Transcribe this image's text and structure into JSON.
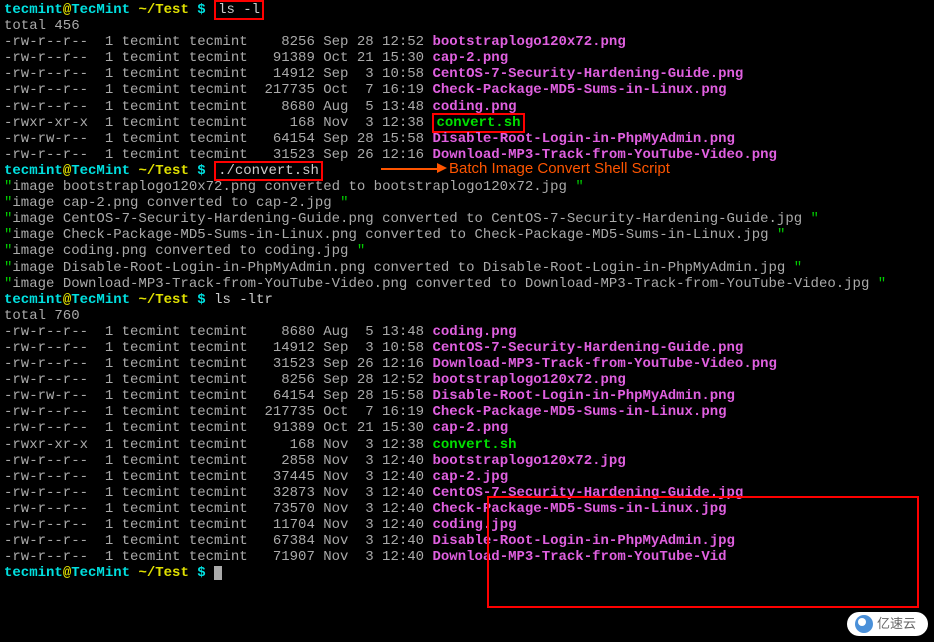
{
  "prompt1": {
    "user": "tecmint",
    "at": "@",
    "host": "TecMint",
    "path": "~/Test",
    "dollar": "$",
    "cmd": "ls -l"
  },
  "total1": "total 456",
  "ls1": [
    {
      "perm": "-rw-r--r--",
      "n": "1",
      "u": "tecmint",
      "g": "tecmint",
      "size": "   8256",
      "date": "Sep 28 12:52",
      "file": "bootstraplogo120x72.png",
      "cls": "png"
    },
    {
      "perm": "-rw-r--r--",
      "n": "1",
      "u": "tecmint",
      "g": "tecmint",
      "size": "  91389",
      "date": "Oct 21 15:30",
      "file": "cap-2.png",
      "cls": "png"
    },
    {
      "perm": "-rw-r--r--",
      "n": "1",
      "u": "tecmint",
      "g": "tecmint",
      "size": "  14912",
      "date": "Sep  3 10:58",
      "file": "CentOS-7-Security-Hardening-Guide.png",
      "cls": "png"
    },
    {
      "perm": "-rw-r--r--",
      "n": "1",
      "u": "tecmint",
      "g": "tecmint",
      "size": " 217735",
      "date": "Oct  7 16:19",
      "file": "Check-Package-MD5-Sums-in-Linux.png",
      "cls": "png"
    },
    {
      "perm": "-rw-r--r--",
      "n": "1",
      "u": "tecmint",
      "g": "tecmint",
      "size": "   8680",
      "date": "Aug  5 13:48",
      "file": "coding.png",
      "cls": "png"
    },
    {
      "perm": "-rwxr-xr-x",
      "n": "1",
      "u": "tecmint",
      "g": "tecmint",
      "size": "    168",
      "date": "Nov  3 12:38",
      "file": "convert.sh",
      "cls": "sh",
      "box": true
    },
    {
      "perm": "-rw-rw-r--",
      "n": "1",
      "u": "tecmint",
      "g": "tecmint",
      "size": "  64154",
      "date": "Sep 28 15:58",
      "file": "Disable-Root-Login-in-PhpMyAdmin.png",
      "cls": "png"
    },
    {
      "perm": "-rw-r--r--",
      "n": "1",
      "u": "tecmint",
      "g": "tecmint",
      "size": "  31523",
      "date": "Sep 26 12:16",
      "file": "Download-MP3-Track-from-YouTube-Video.png",
      "cls": "png"
    }
  ],
  "prompt2": {
    "user": "tecmint",
    "at": "@",
    "host": "TecMint",
    "path": "~/Test",
    "dollar": "$",
    "cmd": "./convert.sh"
  },
  "annotation": "Batch Image Convert Shell Script",
  "output": [
    "\"image bootstraplogo120x72.png converted to bootstraplogo120x72.jpg \"",
    "\"image cap-2.png converted to cap-2.jpg \"",
    "\"image CentOS-7-Security-Hardening-Guide.png converted to CentOS-7-Security-Hardening-Guide.jpg \"",
    "\"image Check-Package-MD5-Sums-in-Linux.png converted to Check-Package-MD5-Sums-in-Linux.jpg \"",
    "\"image coding.png converted to coding.jpg \"",
    "\"image Disable-Root-Login-in-PhpMyAdmin.png converted to Disable-Root-Login-in-PhpMyAdmin.jpg \"",
    "\"image Download-MP3-Track-from-YouTube-Video.png converted to Download-MP3-Track-from-YouTube-Video.jpg \""
  ],
  "prompt3": {
    "user": "tecmint",
    "at": "@",
    "host": "TecMint",
    "path": "~/Test",
    "dollar": "$",
    "cmd": "ls -ltr"
  },
  "total2": "total 760",
  "ls2": [
    {
      "perm": "-rw-r--r--",
      "n": "1",
      "u": "tecmint",
      "g": "tecmint",
      "size": "   8680",
      "date": "Aug  5 13:48",
      "file": "coding.png",
      "cls": "png"
    },
    {
      "perm": "-rw-r--r--",
      "n": "1",
      "u": "tecmint",
      "g": "tecmint",
      "size": "  14912",
      "date": "Sep  3 10:58",
      "file": "CentOS-7-Security-Hardening-Guide.png",
      "cls": "png"
    },
    {
      "perm": "-rw-r--r--",
      "n": "1",
      "u": "tecmint",
      "g": "tecmint",
      "size": "  31523",
      "date": "Sep 26 12:16",
      "file": "Download-MP3-Track-from-YouTube-Video.png",
      "cls": "png"
    },
    {
      "perm": "-rw-r--r--",
      "n": "1",
      "u": "tecmint",
      "g": "tecmint",
      "size": "   8256",
      "date": "Sep 28 12:52",
      "file": "bootstraplogo120x72.png",
      "cls": "png"
    },
    {
      "perm": "-rw-rw-r--",
      "n": "1",
      "u": "tecmint",
      "g": "tecmint",
      "size": "  64154",
      "date": "Sep 28 15:58",
      "file": "Disable-Root-Login-in-PhpMyAdmin.png",
      "cls": "png"
    },
    {
      "perm": "-rw-r--r--",
      "n": "1",
      "u": "tecmint",
      "g": "tecmint",
      "size": " 217735",
      "date": "Oct  7 16:19",
      "file": "Check-Package-MD5-Sums-in-Linux.png",
      "cls": "png"
    },
    {
      "perm": "-rw-r--r--",
      "n": "1",
      "u": "tecmint",
      "g": "tecmint",
      "size": "  91389",
      "date": "Oct 21 15:30",
      "file": "cap-2.png",
      "cls": "png"
    },
    {
      "perm": "-rwxr-xr-x",
      "n": "1",
      "u": "tecmint",
      "g": "tecmint",
      "size": "    168",
      "date": "Nov  3 12:38",
      "file": "convert.sh",
      "cls": "sh"
    },
    {
      "perm": "-rw-r--r--",
      "n": "1",
      "u": "tecmint",
      "g": "tecmint",
      "size": "   2858",
      "date": "Nov  3 12:40",
      "file": "bootstraplogo120x72.jpg",
      "cls": "png"
    },
    {
      "perm": "-rw-r--r--",
      "n": "1",
      "u": "tecmint",
      "g": "tecmint",
      "size": "  37445",
      "date": "Nov  3 12:40",
      "file": "cap-2.jpg",
      "cls": "png"
    },
    {
      "perm": "-rw-r--r--",
      "n": "1",
      "u": "tecmint",
      "g": "tecmint",
      "size": "  32873",
      "date": "Nov  3 12:40",
      "file": "CentOS-7-Security-Hardening-Guide.jpg",
      "cls": "png"
    },
    {
      "perm": "-rw-r--r--",
      "n": "1",
      "u": "tecmint",
      "g": "tecmint",
      "size": "  73570",
      "date": "Nov  3 12:40",
      "file": "Check-Package-MD5-Sums-in-Linux.jpg",
      "cls": "png"
    },
    {
      "perm": "-rw-r--r--",
      "n": "1",
      "u": "tecmint",
      "g": "tecmint",
      "size": "  11704",
      "date": "Nov  3 12:40",
      "file": "coding.jpg",
      "cls": "png"
    },
    {
      "perm": "-rw-r--r--",
      "n": "1",
      "u": "tecmint",
      "g": "tecmint",
      "size": "  67384",
      "date": "Nov  3 12:40",
      "file": "Disable-Root-Login-in-PhpMyAdmin.jpg",
      "cls": "png"
    },
    {
      "perm": "-rw-r--r--",
      "n": "1",
      "u": "tecmint",
      "g": "tecmint",
      "size": "  71907",
      "date": "Nov  3 12:40",
      "file": "Download-MP3-Track-from-YouTube-Vid",
      "cls": "png",
      "trunc": true
    }
  ],
  "prompt4": {
    "user": "tecmint",
    "at": "@",
    "host": "TecMint",
    "path": "~/Test",
    "dollar": "$"
  },
  "watermark": "亿速云"
}
